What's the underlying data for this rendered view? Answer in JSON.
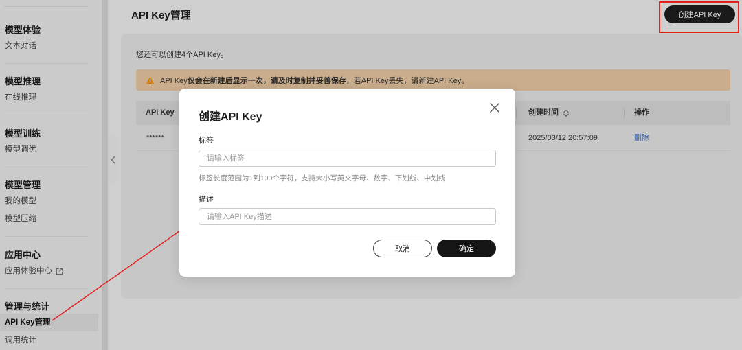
{
  "sidebar": {
    "groups": [
      {
        "title": "模型体验",
        "items": [
          {
            "label": "文本对话"
          }
        ]
      },
      {
        "title": "模型推理",
        "items": [
          {
            "label": "在线推理"
          }
        ]
      },
      {
        "title": "模型训练",
        "items": [
          {
            "label": "模型调优"
          }
        ]
      },
      {
        "title": "模型管理",
        "items": [
          {
            "label": "我的模型"
          },
          {
            "label": "模型压缩"
          }
        ]
      },
      {
        "title": "应用中心",
        "items": [
          {
            "label": "应用体验中心"
          }
        ]
      },
      {
        "title": "管理与统计",
        "items": [
          {
            "label": "API Key管理"
          },
          {
            "label": "调用统计"
          }
        ]
      }
    ],
    "active_item": "API Key管理"
  },
  "header": {
    "title": "API Key管理",
    "create_button": "创建API Key"
  },
  "main": {
    "remaining_text": "您还可以创建4个API Key。",
    "warning": {
      "prefix": "API Key",
      "bold": "仅会在新建后显示一次，请及时复制并妥善保存",
      "suffix": "，若API Key丢失，请新建API Key。"
    },
    "table": {
      "columns": [
        "API Key",
        "创建时间",
        "操作"
      ],
      "rows": [
        {
          "api_key": "******",
          "created_at": "2025/03/12 20:57:09",
          "action": "删除"
        }
      ]
    }
  },
  "modal": {
    "title": "创建API Key",
    "label_field": {
      "label": "标签",
      "placeholder": "请输入标签",
      "hint": "标签长度范围为1到100个字符，支持大小写英文字母、数字、下划线、中划线"
    },
    "desc_field": {
      "label": "描述",
      "placeholder": "请输入API Key描述"
    },
    "cancel": "取消",
    "confirm": "确定"
  },
  "colors": {
    "highlight": "#e51e1e",
    "primary_button": "#151515",
    "link": "#2f5fb8",
    "warning_bg": "#c9ad8c"
  }
}
